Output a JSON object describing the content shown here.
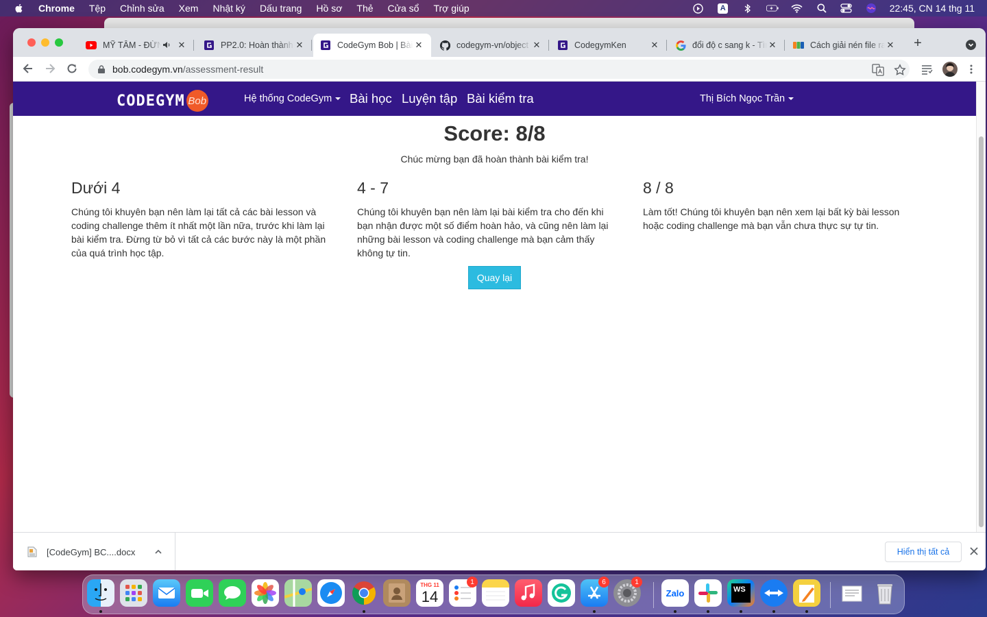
{
  "menubar": {
    "app": "Chrome",
    "items": [
      "Tệp",
      "Chỉnh sửa",
      "Xem",
      "Nhật ký",
      "Dấu trang",
      "Hồ sơ",
      "Thẻ",
      "Cửa sổ",
      "Trợ giúp"
    ],
    "clock": "22:45, CN 14 thg 11",
    "input_source": "A"
  },
  "browser": {
    "tabs": [
      {
        "title": "MỸ TÂM - ĐỪNG HỎI EM",
        "favicon": "youtube-icon",
        "audio": true
      },
      {
        "title": "PP2.0: Hoàn thành",
        "favicon": "codegym-icon"
      },
      {
        "title": "CodeGym Bob | Bài kiểm tra",
        "favicon": "codegym-icon",
        "active": true
      },
      {
        "title": "codegym-vn/object",
        "favicon": "github-icon"
      },
      {
        "title": "CodegymKen",
        "favicon": "codegym-icon"
      },
      {
        "title": "đổi độ c sang k - Tìm trên Google",
        "favicon": "google-icon"
      },
      {
        "title": "Cách giải nén file rar",
        "favicon": "fpt-icon"
      }
    ],
    "url_host": "bob.codegym.vn",
    "url_path": "/assessment-result"
  },
  "site": {
    "logo_text": "CODEGYM",
    "logo_badge": "Bob",
    "nav": {
      "system": "Hệ thống CodeGym",
      "lessons": "Bài học",
      "practice": "Luyện tập",
      "tests": "Bài kiểm tra",
      "user": "Thị Bích Ngọc Trần"
    }
  },
  "result": {
    "score": "Score: 8/8",
    "congrats": "Chúc mừng bạn đã hoàn thành bài kiểm tra!",
    "columns": [
      {
        "heading": "Dưới 4",
        "text": "Chúng tôi khuyên bạn nên làm lại tất cả các bài lesson và coding challenge thêm ít nhất một lần nữa, trước khi làm lại bài kiểm tra. Đừng từ bỏ vì tất cả các bước này là một phần của quá trình học tập."
      },
      {
        "heading": "4 - 7",
        "text": "Chúng tôi khuyên bạn nên làm lại bài kiểm tra cho đến khi bạn nhận được một số điểm hoàn hảo, và cũng nên làm lại những bài lesson và coding challenge mà bạn cảm thấy không tự tin."
      },
      {
        "heading": "8 / 8",
        "text": "Làm tốt! Chúng tôi khuyên bạn nên xem lại bất kỳ bài lesson hoặc coding challenge mà bạn vẫn chưa thực sự tự tin."
      }
    ],
    "back_button": "Quay lại"
  },
  "downloads": {
    "file_name": "[CodeGym] BC....docx",
    "show_all": "Hiển thị tất cả"
  },
  "dock": {
    "calendar_month": "THG 11",
    "calendar_day": "14",
    "badges": {
      "reminders": "1",
      "appstore": "6",
      "settings": "1"
    },
    "zalo_label": "Zalo",
    "webstorm_label": "WS"
  }
}
